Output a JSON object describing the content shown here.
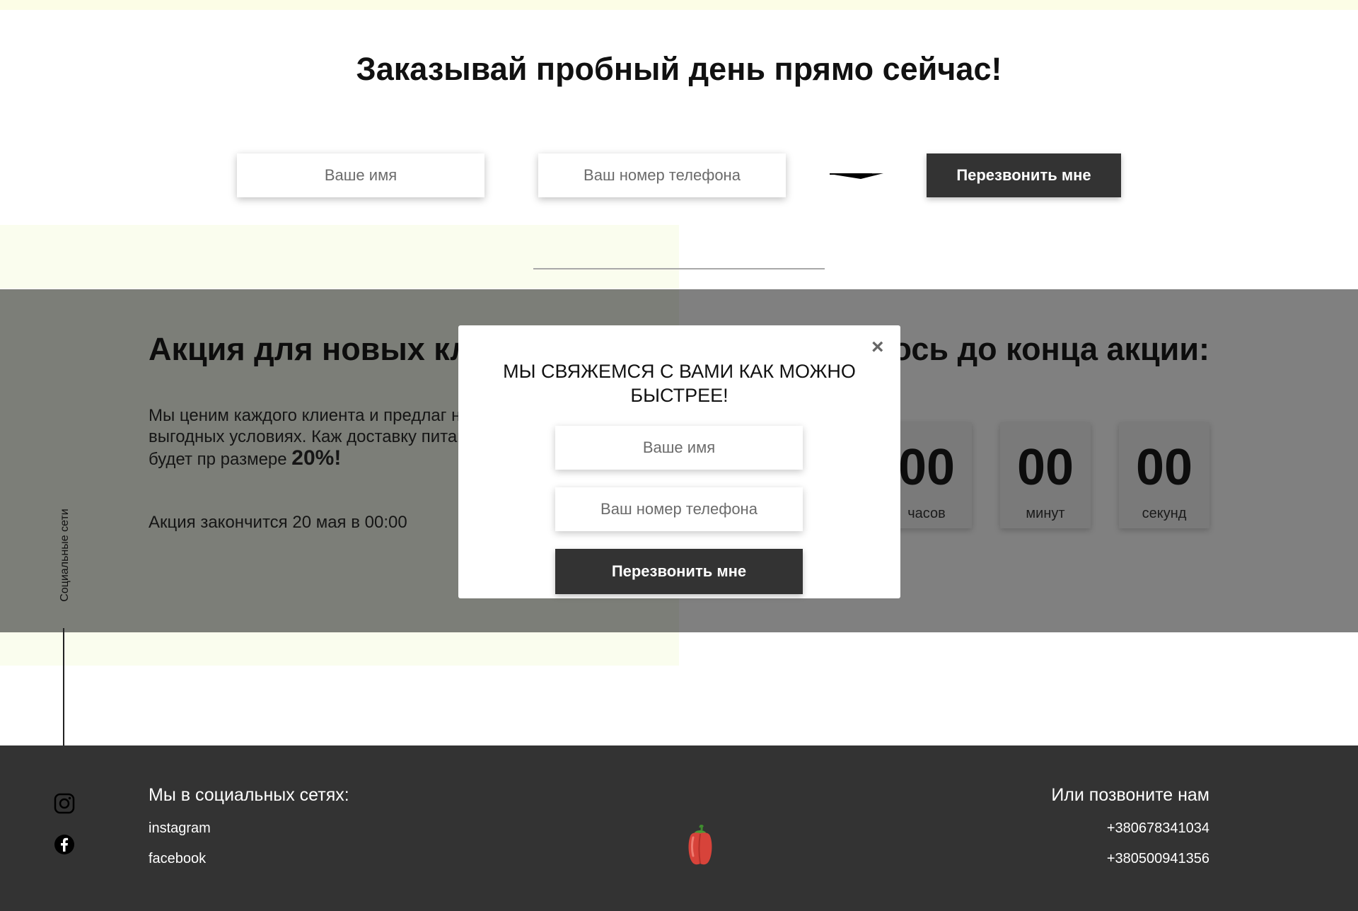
{
  "order": {
    "title": "Заказывай пробный день прямо сейчас!",
    "name_placeholder": "Ваше имя",
    "phone_placeholder": "Ваш номер телефона",
    "call_button": "Перезвонить мне"
  },
  "promo": {
    "title": "Акция для новых кли",
    "text_before": "Мы ценим каждого клиента и предлаг них на очень выгодных условиях. Каж доставку питание на неделю, будет пр размере ",
    "discount": "20%!",
    "end_text": "Акция закончится 20 мая в 00:00"
  },
  "timer": {
    "title": "лось до конца акции:",
    "hours": {
      "value": "00",
      "label": "часов"
    },
    "minutes": {
      "value": "00",
      "label": "минут"
    },
    "seconds": {
      "value": "00",
      "label": "секунд"
    }
  },
  "side": {
    "label": "Социальные сети",
    "icons": [
      "instagram-icon",
      "facebook-icon"
    ]
  },
  "footer": {
    "social_heading": "Мы в социальных сетях:",
    "instagram": "instagram",
    "facebook": "facebook",
    "call_heading": "Или позвоните нам",
    "phone1": "+380678341034",
    "phone2": "+380500941356",
    "logo_icon": "pepper-icon"
  },
  "modal": {
    "close": "×",
    "title": "Мы свяжемся с вами как можно быстрее!",
    "name_placeholder": "Ваше имя",
    "phone_placeholder": "Ваш номер телефона",
    "button": "Перезвонить мне"
  },
  "colors": {
    "dark": "#333333",
    "overlay": "#808080",
    "pale_accent": "#fafdee",
    "white": "#ffffff"
  }
}
